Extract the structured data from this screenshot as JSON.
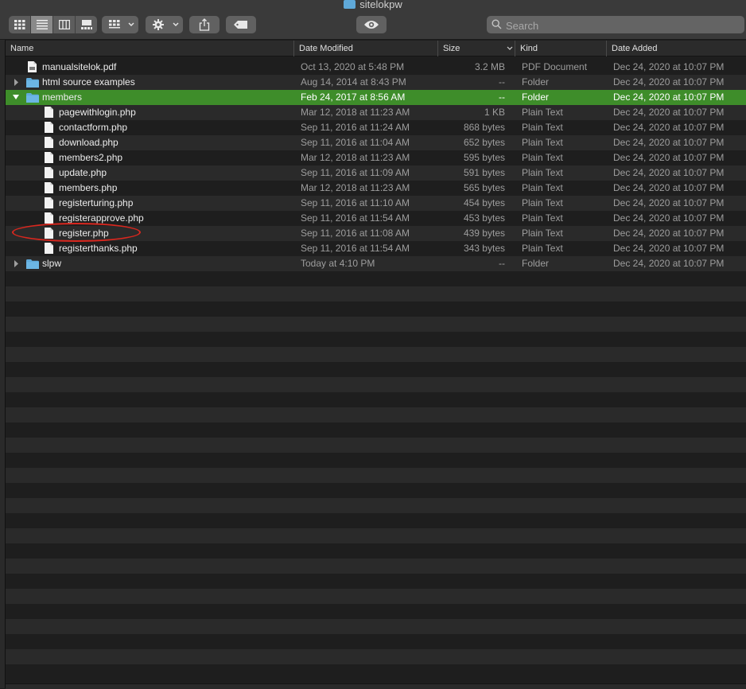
{
  "window": {
    "title": "sitelokpw",
    "title_icon": "folder-icon"
  },
  "toolbar": {
    "view_icons": [
      "icon-view-icon",
      "list-view-icon",
      "column-view-icon",
      "gallery-view-icon"
    ],
    "active_view": 1,
    "group_icon": "group-by-icon",
    "action_icon": "gear-icon",
    "share_icon": "share-icon",
    "tag_icon": "tag-icon",
    "quicklook_icon": "eye-icon",
    "search_placeholder": "Search",
    "search_value": ""
  },
  "columns": {
    "name": "Name",
    "date_modified": "Date Modified",
    "size": "Size",
    "kind": "Kind",
    "date_added": "Date Added"
  },
  "files": [
    {
      "name": "manualsitelok.pdf",
      "modified": "Oct 13, 2020 at 5:48 PM",
      "size": "3.2 MB",
      "kind": "PDF Document",
      "added": "Dec 24, 2020 at 10:07 PM",
      "type": "pdf",
      "depth": 0,
      "disclosure": "none",
      "selected": false
    },
    {
      "name": "html source examples",
      "modified": "Aug 14, 2014 at 8:43 PM",
      "size": "--",
      "kind": "Folder",
      "added": "Dec 24, 2020 at 10:07 PM",
      "type": "folder",
      "depth": 0,
      "disclosure": "collapsed",
      "selected": false
    },
    {
      "name": "members",
      "modified": "Feb 24, 2017 at 8:56 AM",
      "size": "--",
      "kind": "Folder",
      "added": "Dec 24, 2020 at 10:07 PM",
      "type": "folder",
      "depth": 0,
      "disclosure": "expanded",
      "selected": true
    },
    {
      "name": "pagewithlogin.php",
      "modified": "Mar 12, 2018 at 11:23 AM",
      "size": "1 KB",
      "kind": "Plain Text",
      "added": "Dec 24, 2020 at 10:07 PM",
      "type": "file",
      "depth": 1,
      "disclosure": "none",
      "selected": false
    },
    {
      "name": "contactform.php",
      "modified": "Sep 11, 2016 at 11:24 AM",
      "size": "868 bytes",
      "kind": "Plain Text",
      "added": "Dec 24, 2020 at 10:07 PM",
      "type": "file",
      "depth": 1,
      "disclosure": "none",
      "selected": false
    },
    {
      "name": "download.php",
      "modified": "Sep 11, 2016 at 11:04 AM",
      "size": "652 bytes",
      "kind": "Plain Text",
      "added": "Dec 24, 2020 at 10:07 PM",
      "type": "file",
      "depth": 1,
      "disclosure": "none",
      "selected": false
    },
    {
      "name": "members2.php",
      "modified": "Mar 12, 2018 at 11:23 AM",
      "size": "595 bytes",
      "kind": "Plain Text",
      "added": "Dec 24, 2020 at 10:07 PM",
      "type": "file",
      "depth": 1,
      "disclosure": "none",
      "selected": false
    },
    {
      "name": "update.php",
      "modified": "Sep 11, 2016 at 11:09 AM",
      "size": "591 bytes",
      "kind": "Plain Text",
      "added": "Dec 24, 2020 at 10:07 PM",
      "type": "file",
      "depth": 1,
      "disclosure": "none",
      "selected": false
    },
    {
      "name": "members.php",
      "modified": "Mar 12, 2018 at 11:23 AM",
      "size": "565 bytes",
      "kind": "Plain Text",
      "added": "Dec 24, 2020 at 10:07 PM",
      "type": "file",
      "depth": 1,
      "disclosure": "none",
      "selected": false
    },
    {
      "name": "registerturing.php",
      "modified": "Sep 11, 2016 at 11:10 AM",
      "size": "454 bytes",
      "kind": "Plain Text",
      "added": "Dec 24, 2020 at 10:07 PM",
      "type": "file",
      "depth": 1,
      "disclosure": "none",
      "selected": false
    },
    {
      "name": "registerapprove.php",
      "modified": "Sep 11, 2016 at 11:54 AM",
      "size": "453 bytes",
      "kind": "Plain Text",
      "added": "Dec 24, 2020 at 10:07 PM",
      "type": "file",
      "depth": 1,
      "disclosure": "none",
      "selected": false
    },
    {
      "name": "register.php",
      "modified": "Sep 11, 2016 at 11:08 AM",
      "size": "439 bytes",
      "kind": "Plain Text",
      "added": "Dec 24, 2020 at 10:07 PM",
      "type": "file",
      "depth": 1,
      "disclosure": "none",
      "selected": false,
      "annotated": true
    },
    {
      "name": "registerthanks.php",
      "modified": "Sep 11, 2016 at 11:54 AM",
      "size": "343 bytes",
      "kind": "Plain Text",
      "added": "Dec 24, 2020 at 10:07 PM",
      "type": "file",
      "depth": 1,
      "disclosure": "none",
      "selected": false
    },
    {
      "name": "slpw",
      "modified": "Today at 4:10 PM",
      "size": "--",
      "kind": "Folder",
      "added": "Dec 24, 2020 at 10:07 PM",
      "type": "folder",
      "depth": 0,
      "disclosure": "collapsed",
      "selected": false
    }
  ],
  "colors": {
    "selection": "#3e8d2a",
    "folder": "#5fa9d9",
    "annotation": "#d9271e"
  }
}
